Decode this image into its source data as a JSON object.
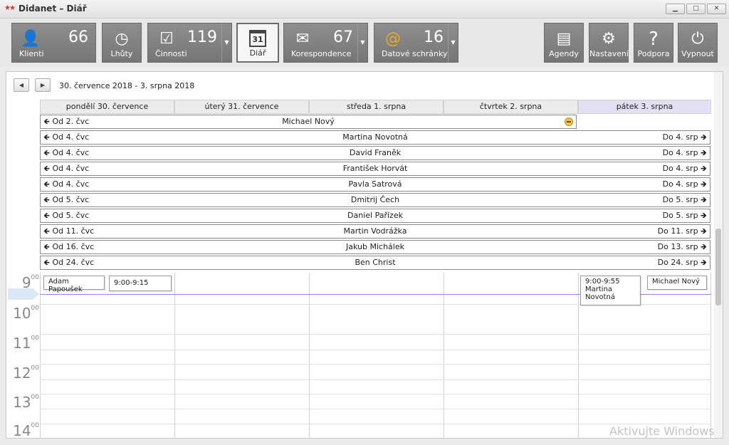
{
  "window": {
    "title": "Didanet – Diář",
    "logo": "★★",
    "minimize_icon": "minimize-icon",
    "maximize_icon": "maximize-icon",
    "close_icon": "close-icon"
  },
  "toolbar": {
    "klienti": {
      "label": "Klienti",
      "count": "66",
      "icon": "clients-icon"
    },
    "lhuty": {
      "label": "Lhůty",
      "icon": "deadline-clock-icon"
    },
    "cinnosti": {
      "label": "Činnosti",
      "count": "119",
      "icon": "clipboard-check-icon"
    },
    "diar": {
      "label": "Diář",
      "icon": "calendar-icon",
      "day": "31"
    },
    "korespondence": {
      "label": "Korespondence",
      "count": "67",
      "icon": "envelope-icon"
    },
    "schranky": {
      "label": "Datové schránky",
      "count": "16",
      "icon": "data-box-icon"
    },
    "agendy": {
      "label": "Agendy",
      "icon": "cabinet-icon"
    },
    "nastaveni": {
      "label": "Nastavení",
      "icon": "gear-icon"
    },
    "podpora": {
      "label": "Podpora",
      "icon": "help-icon"
    },
    "vypnout": {
      "label": "Vypnout",
      "icon": "power-icon"
    }
  },
  "calendar": {
    "range": "30. července 2018 - 3. srpna 2018",
    "days": [
      "pondělí 30. července",
      "úterý 31. července",
      "středa 1. srpna",
      "čtvrtek 2. srpna",
      "pátek 3. srpna"
    ],
    "all_day_events": [
      {
        "from": "Od 2. čvc",
        "name": "Michael Nový",
        "to": ""
      },
      {
        "from": "Od 4. čvc",
        "name": "Martina Novotná",
        "to": "Do 4. srp"
      },
      {
        "from": "Od 4. čvc",
        "name": "David Franěk",
        "to": "Do 4. srp"
      },
      {
        "from": "Od 4. čvc",
        "name": "František Horvát",
        "to": "Do 4. srp"
      },
      {
        "from": "Od 4. čvc",
        "name": "Pavla Satrová",
        "to": "Do 4. srp"
      },
      {
        "from": "Od 5. čvc",
        "name": "Dmitrij Čech",
        "to": "Do 5. srp"
      },
      {
        "from": "Od 5. čvc",
        "name": "Daniel Pařízek",
        "to": "Do 5. srp"
      },
      {
        "from": "Od 11. čvc",
        "name": "Martin Vodrážka",
        "to": "Do 11. srp"
      },
      {
        "from": "Od 16. čvc",
        "name": "Jakub Michálek",
        "to": "Do 13. srp"
      },
      {
        "from": "Od 24. čvc",
        "name": "Ben Christ",
        "to": "Do 24. srp"
      }
    ],
    "hours": [
      "9",
      "10",
      "11",
      "12",
      "13",
      "14"
    ],
    "minutes_label": "00",
    "appointments": {
      "mon_name": "Adam Papoušek",
      "mon_time": "9:00-9:15",
      "fri_time": "9:00-9:55",
      "fri_name_line1": "Martina",
      "fri_name_line2": "Novotná",
      "fri_name2": "Michael Nový"
    }
  },
  "watermark": "Aktivujte Windows"
}
